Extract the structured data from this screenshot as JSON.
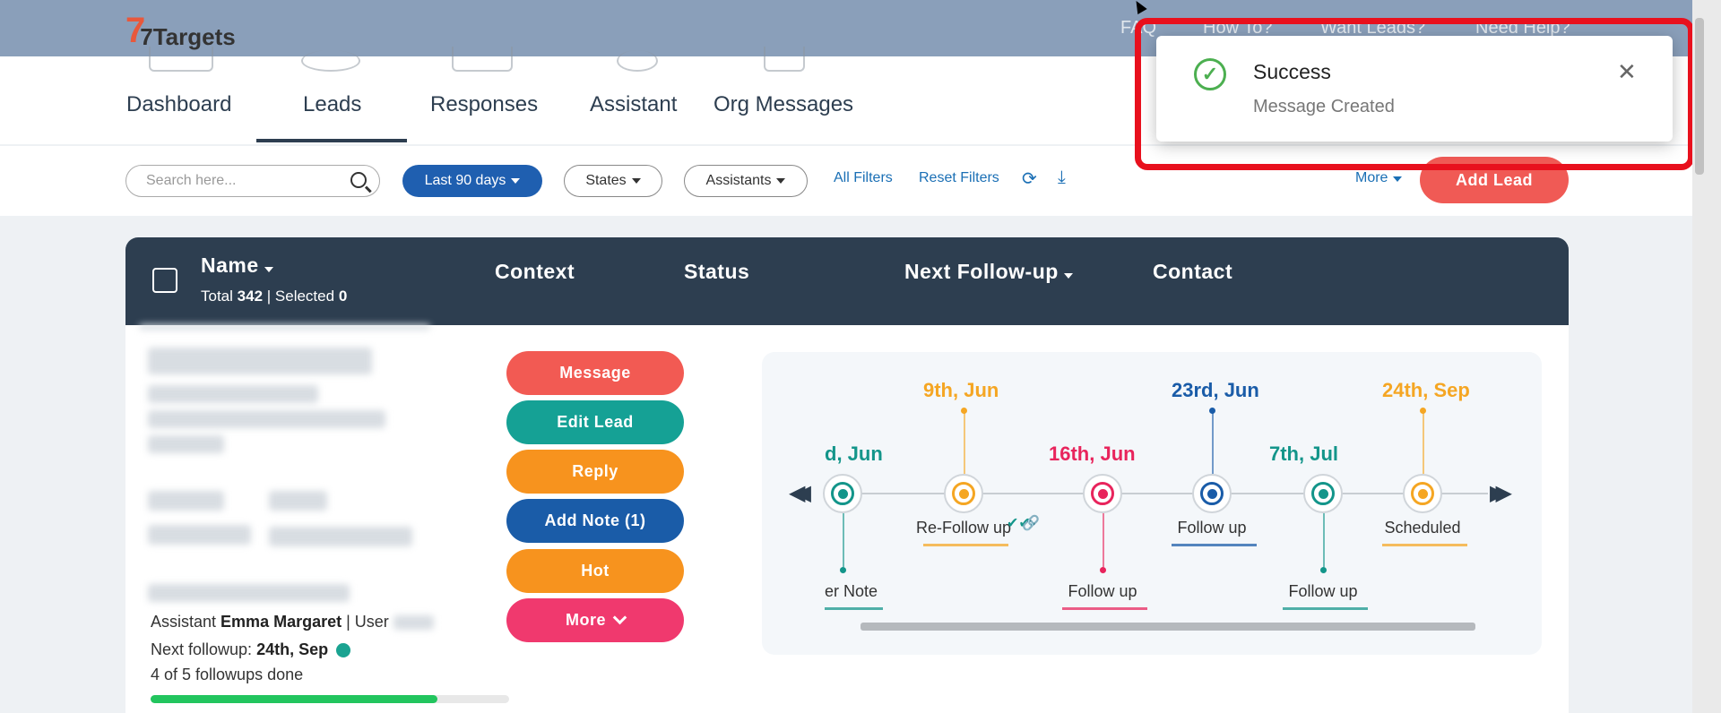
{
  "brand": {
    "logo_text": "7Targets",
    "logo_mark": "7"
  },
  "top_links": [
    "FAQ",
    "How To?",
    "Want Leads?",
    "Need Help?"
  ],
  "tabs": [
    {
      "label": "Dashboard",
      "active": false
    },
    {
      "label": "Leads",
      "active": true
    },
    {
      "label": "Responses",
      "active": false
    },
    {
      "label": "Assistant",
      "active": false
    },
    {
      "label": "Org Messages",
      "active": false
    }
  ],
  "filters": {
    "search_placeholder": "Search here...",
    "date_range": "Last 90 days",
    "states": "States",
    "assistants": "Assistants",
    "all_filters": "All Filters",
    "reset_filters": "Reset Filters",
    "more": "More",
    "add_lead": "Add Lead"
  },
  "table_header": {
    "name": "Name",
    "total_label": "Total",
    "total": "342",
    "selected_label": "Selected",
    "selected": "0",
    "context": "Context",
    "status": "Status",
    "next_followup": "Next Follow-up",
    "contact": "Contact"
  },
  "lead": {
    "assistant_label": "Assistant",
    "assistant_name": "Emma Margaret",
    "user_label": "User",
    "next_followup_label": "Next followup:",
    "next_followup": "24th, Sep",
    "followups_done": "4 of 5 followups done",
    "progress_fraction": 0.8
  },
  "actions": [
    {
      "label": "Message",
      "color": "#f25a53"
    },
    {
      "label": "Edit Lead",
      "color": "#15a195"
    },
    {
      "label": "Reply",
      "color": "#f7931e"
    },
    {
      "label": "Add Note (1)",
      "color": "#1a5ca8"
    },
    {
      "label": "Hot",
      "color": "#f7931e"
    },
    {
      "label": "More",
      "color": "#f0396e"
    }
  ],
  "timeline": [
    {
      "date": "d, Jun",
      "label": "er Note",
      "color": "#13958a",
      "above": false
    },
    {
      "date": "9th, Jun",
      "label": "Re-Follow up",
      "color": "#f5a623",
      "above": true
    },
    {
      "date": "16th, Jun",
      "label": "Follow up",
      "color": "#e8245c",
      "above": false
    },
    {
      "date": "23rd, Jun",
      "label": "Follow up",
      "color": "#1a5ca8",
      "above": true
    },
    {
      "date": "7th, Jul",
      "label": "Follow up",
      "color": "#13958a",
      "above": false
    },
    {
      "date": "24th, Sep",
      "label": "Scheduled",
      "color": "#f5a623",
      "above": true
    }
  ],
  "toast": {
    "title": "Success",
    "message": "Message Created"
  }
}
